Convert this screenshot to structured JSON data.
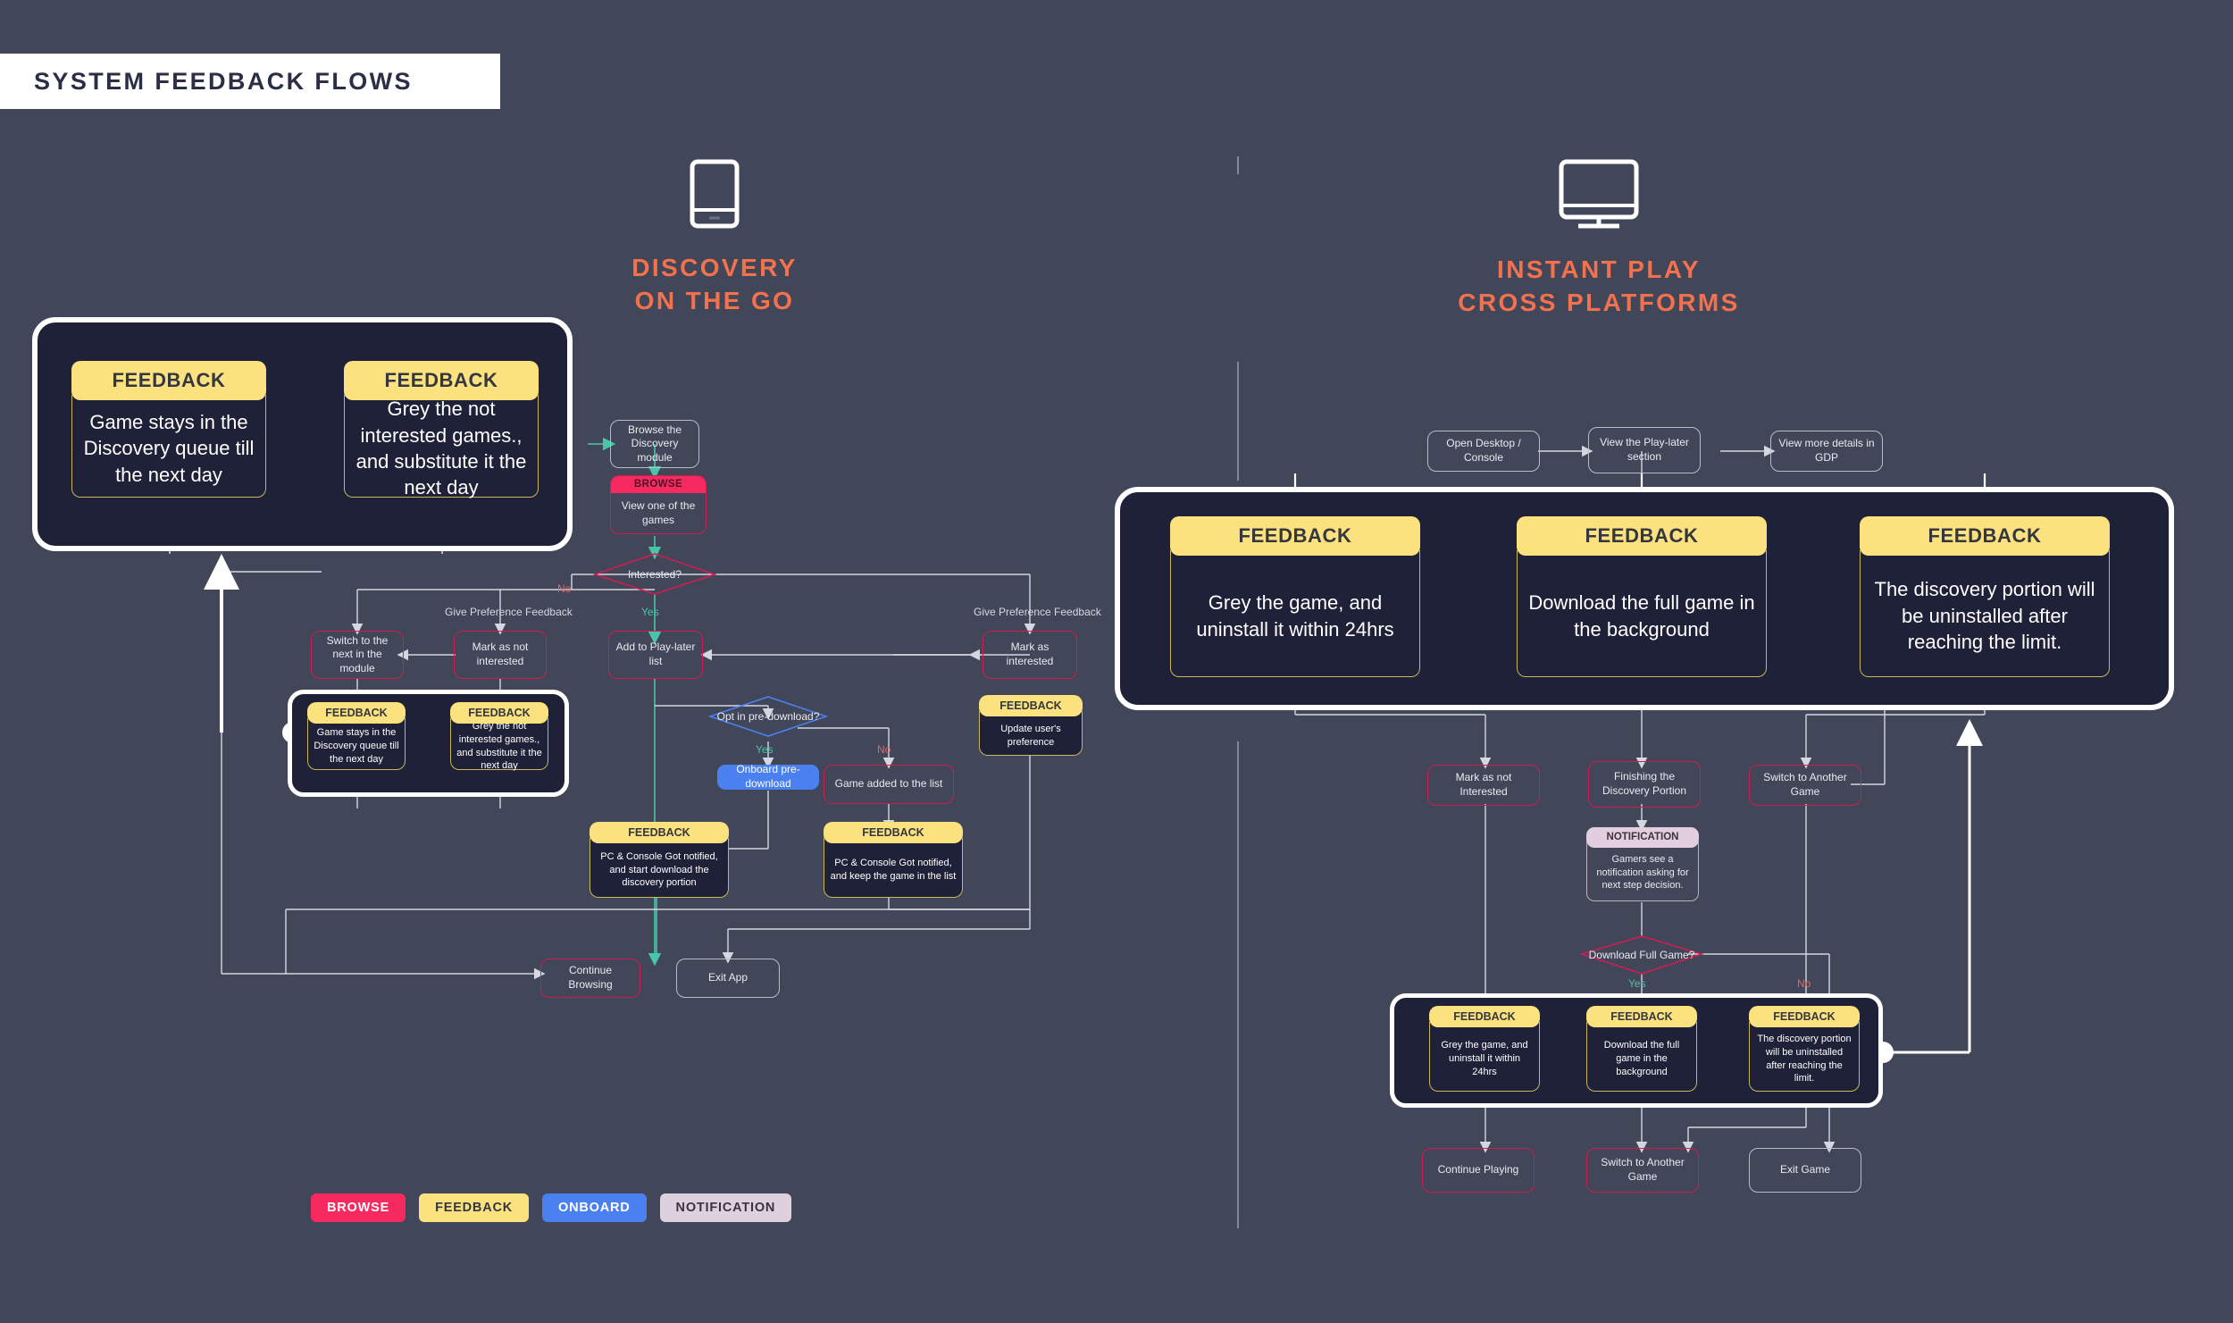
{
  "page": {
    "title": "SYSTEM FEEDBACK FLOWS",
    "background_color": "#424659",
    "panel_color": "#1e2138",
    "accent_color": "#f4714e"
  },
  "sections": {
    "left": {
      "icon": "mobile-device-icon",
      "line1": "DISCOVERY",
      "line2": "ON THE GO"
    },
    "right": {
      "icon": "desktop-monitor-icon",
      "line1": "INSTANT PLAY",
      "line2": "CROSS PLATFORMS"
    }
  },
  "legend": [
    {
      "label": "BROWSE",
      "bg": "#f72a5f",
      "fg": "#ffffff"
    },
    {
      "label": "FEEDBACK",
      "bg": "#fbe27f",
      "fg": "#34373f"
    },
    {
      "label": "ONBOARD",
      "bg": "#4a80f0",
      "fg": "#ffffff"
    },
    {
      "label": "NOTIFICATION",
      "bg": "#ded0dc",
      "fg": "#3b3340"
    }
  ],
  "feedback_label": "FEEDBACK",
  "notification_label": "NOTIFICATION",
  "browse_label": "BROWSE",
  "left_callouts": [
    {
      "header": "FEEDBACK",
      "text": "Game stays in the Discovery queue till the next day"
    },
    {
      "header": "FEEDBACK",
      "text": "Grey the not interested games., and substitute it the next day"
    }
  ],
  "right_callouts": [
    {
      "header": "FEEDBACK",
      "text": "Grey the game, and uninstall it within 24hrs"
    },
    {
      "header": "FEEDBACK",
      "text": "Download the full game in the background"
    },
    {
      "header": "FEEDBACK",
      "text": "The discovery portion will be uninstalled after reaching the limit."
    }
  ],
  "left_flow": {
    "browse_module": "Browse the Discovery module",
    "view_game_cap": "BROWSE",
    "view_game": "View one of the games",
    "interested_q": "Interested?",
    "no": "No",
    "yes": "Yes",
    "give_pref_left": "Give Preference Feedback",
    "give_pref_right": "Give Preference Feedback",
    "switch_next": "Switch to the next in the module",
    "mark_not_interested": "Mark as not interested",
    "add_play_later": "Add to Play-later list",
    "mark_interested": "Mark as interested",
    "update_pref_fb": "Update user's preference",
    "opt_in_q": "Opt in pre-download?",
    "opt_yes": "Yes",
    "opt_no": "No",
    "onboard_predownload": "Onboard pre-download",
    "game_added": "Game added to the list",
    "fb_start_download": "PC & Console Got notified, and start download the discovery portion",
    "fb_keep_game": "PC & Console Got notified, and keep the game in the list",
    "continue_browsing": "Continue Browsing",
    "exit_app": "Exit App",
    "nested_fb": [
      {
        "header": "FEEDBACK",
        "text": "Game stays in the Discovery queue till the next day"
      },
      {
        "header": "FEEDBACK",
        "text": "Grey the not interested games., and substitute it the next day"
      }
    ]
  },
  "right_flow": {
    "open_desktop": "Open Desktop / Console",
    "view_play_later": "View the Play-later section",
    "view_gdp": "View more details in GDP",
    "mark_not_interested": "Mark as not Interested",
    "finishing_discovery": "Finishing the Discovery Portion",
    "switch_another_game": "Switch to Another Game",
    "notification_header": "NOTIFICATION",
    "notification_text": "Gamers see a notification asking for next step decision.",
    "download_full_q": "Download Full Game?",
    "yes": "Yes",
    "no": "No",
    "nested_fb": [
      {
        "header": "FEEDBACK",
        "text": "Grey the game, and uninstall it within 24hrs"
      },
      {
        "header": "FEEDBACK",
        "text": "Download the full game in the background"
      },
      {
        "header": "FEEDBACK",
        "text": "The discovery portion will be uninstalled after reaching the limit."
      }
    ],
    "continue_playing": "Continue Playing",
    "switch_another_game_2": "Switch to Another Game",
    "exit_game": "Exit Game"
  }
}
